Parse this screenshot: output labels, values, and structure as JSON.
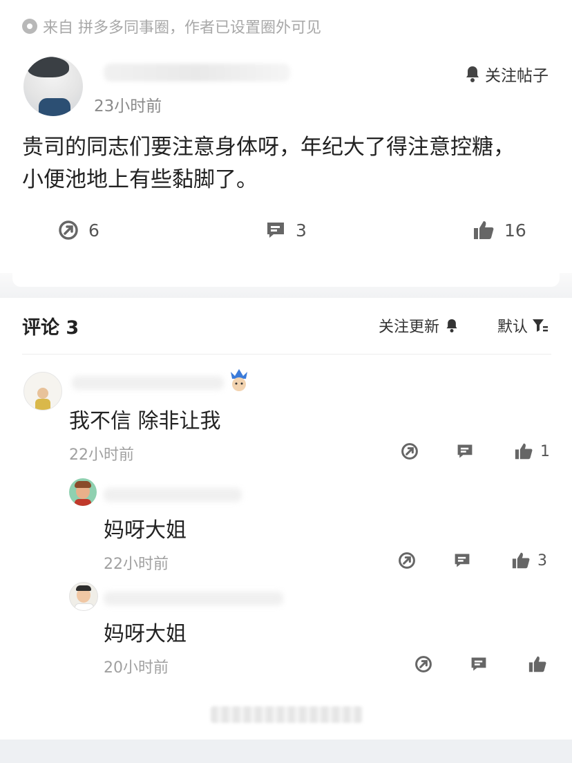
{
  "source_line": "来自 拼多多同事圈，作者已设置圈外可见",
  "post": {
    "time": "23小时前",
    "follow_label": "关注帖子",
    "text_line1": "贵司的同志们要注意身体呀，年纪大了得注意控糖，",
    "text_line2": "小便池地上有些黏脚了。",
    "repost_count": "6",
    "comment_count": "3",
    "like_count": "16"
  },
  "comments_header": {
    "title": "评论 3",
    "follow_updates": "关注更新",
    "sort": "默认"
  },
  "comments": [
    {
      "text": "我不信 除非让我",
      "time": "22小时前",
      "likes": "1"
    },
    {
      "text": "妈呀大姐",
      "time": "22小时前",
      "likes": "3"
    },
    {
      "text": "妈呀大姐",
      "time": "20小时前",
      "likes": ""
    }
  ],
  "icons": {
    "source": "eye-circle-icon",
    "bell": "bell-icon",
    "repost": "repost-icon",
    "comment": "comment-bubble-icon",
    "like": "thumbs-up-icon",
    "filter": "filter-icon"
  }
}
